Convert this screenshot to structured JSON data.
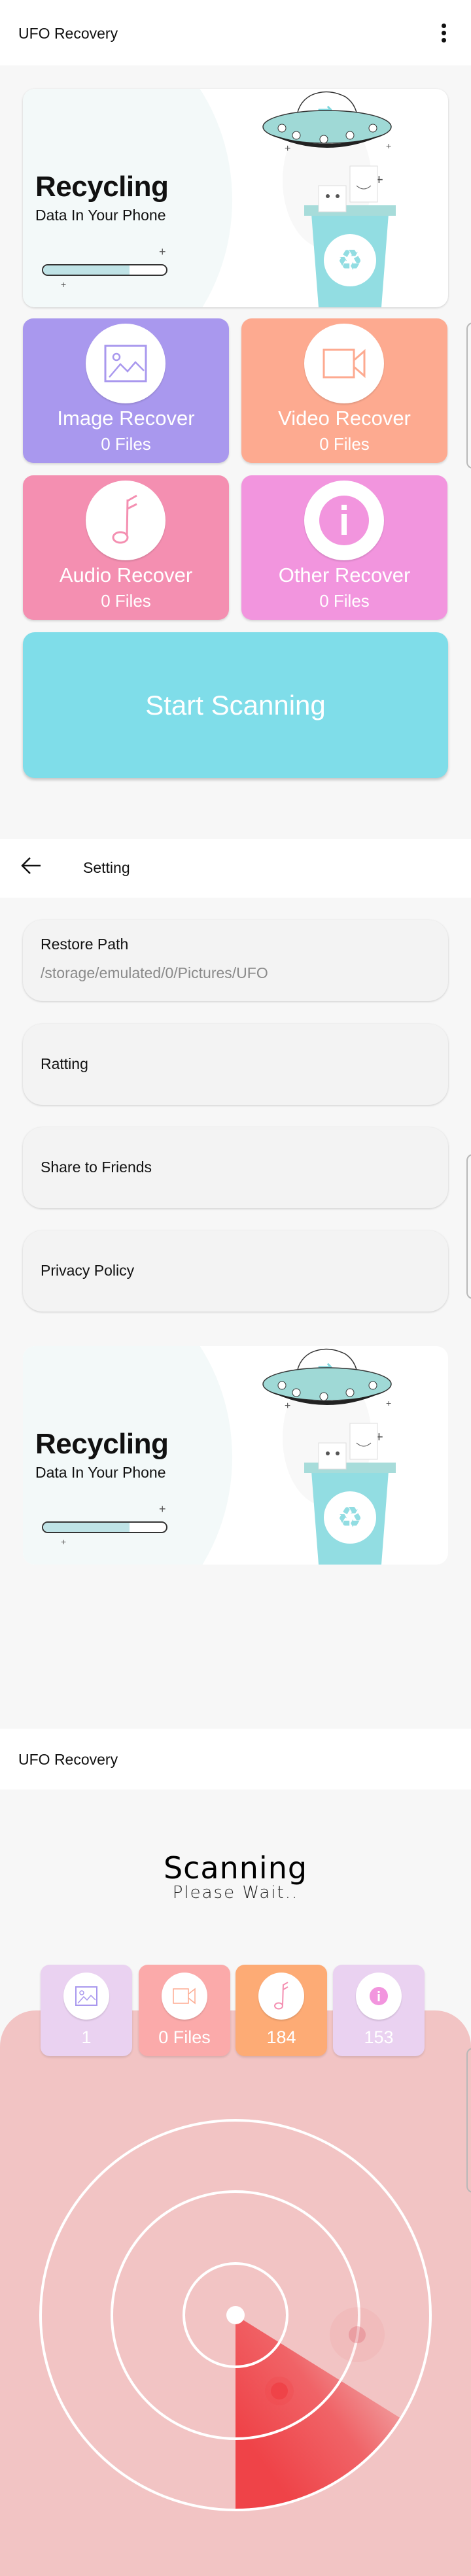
{
  "home": {
    "app_title": "UFO Recovery",
    "menu_icon": "more-vert-icon",
    "banner": {
      "title": "Recycling",
      "subtitle": "Data In Your Phone",
      "progress": 0.7
    },
    "tiles": [
      {
        "label": "Image Recover",
        "count": "0 Files",
        "icon": "image-icon",
        "color": "#a998ee"
      },
      {
        "label": "Video Recover",
        "count": "0 Files",
        "icon": "video-camera-icon",
        "color": "#fdaa90"
      },
      {
        "label": "Audio Recover",
        "count": "0 Files",
        "icon": "music-note-icon",
        "color": "#f48fb1"
      },
      {
        "label": "Other Recover",
        "count": "0 Files",
        "icon": "info-icon",
        "color": "#f295de"
      }
    ],
    "start_button": "Start Scanning",
    "start_color": "#7fdde9"
  },
  "settings": {
    "title": "Setting",
    "back_icon": "arrow-back-icon",
    "items": [
      {
        "label": "Restore Path",
        "value": "/storage/emulated/0/Pictures/UFO"
      },
      {
        "label": "Ratting"
      },
      {
        "label": "Share to Friends"
      },
      {
        "label": "Privacy Policy"
      }
    ],
    "banner": {
      "title": "Recycling",
      "subtitle": "Data In Your Phone",
      "progress": 0.7
    }
  },
  "scanning": {
    "app_title": "UFO Recovery",
    "title": "Scanning",
    "subtitle": "Please Wait..",
    "tiles": [
      {
        "count": "1",
        "icon": "image-icon",
        "color": "#ead2f1"
      },
      {
        "count": "0 Files",
        "icon": "video-camera-icon",
        "color": "#fbaaaa"
      },
      {
        "count": "184",
        "icon": "music-note-icon",
        "color": "#fdab75"
      },
      {
        "count": "153",
        "icon": "info-icon",
        "color": "#ead2f1"
      }
    ],
    "radar_color": "#ef4348",
    "panel_color": "#f2c4c4"
  }
}
